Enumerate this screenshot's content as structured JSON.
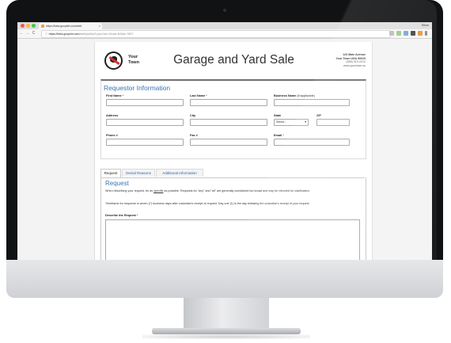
{
  "browser": {
    "tab_title": "https://beta.govpilot.com/web",
    "tab_close": "×",
    "profile_name": "Ethan",
    "nav": {
      "back": "←",
      "forward": "→",
      "reload": "C",
      "secure": "ⓘ"
    },
    "address_host": "https://beta.govpilot.com",
    "address_path": "/web/public/2.php?uid=1&ust=NJ&id=7807"
  },
  "header": {
    "town_line1": "Your",
    "town_line2": "Town",
    "page_title": "Garage and Yard Sale",
    "address_line1": "123 Main Avenue",
    "address_line2": "Your Town USA 90010",
    "address_line3": "(555) 913-2212",
    "address_line4": "www.yourtown.us"
  },
  "requestor": {
    "section_title": "Requestor Information",
    "first_name_label": "First Name",
    "last_name_label": "Last Name",
    "business_name_label": "Business Name",
    "business_name_note": "(if applicable)",
    "address_label": "Address",
    "city_label": "City",
    "state_label": "State",
    "state_value": "Select...",
    "zip_label": "ZIP",
    "phone_label": "Phone #",
    "fax_label": "Fax #",
    "email_label": "Email",
    "required_marker": "*"
  },
  "tabs": [
    "Request",
    "Denial Reasons",
    "Additional Information"
  ],
  "request_panel": {
    "title": "Request",
    "para1_pre": "When describing your request, be as",
    "para1_emph": "specific",
    "para1_post": "as possible. Requests for \"any\" and \"all\" are generally considered too broad and may be returned for clarification.",
    "para2": "Timeframe for response is seven (7) business days after custodian's receipt of request. Day one (1) is the day following the custodian's receipt of your request.",
    "describe_label": "Describe the Request",
    "required_marker": "*"
  },
  "colors": {
    "accent_blue": "#3a75b6",
    "required_red": "#d23030",
    "logo_red": "#d62f2f"
  }
}
